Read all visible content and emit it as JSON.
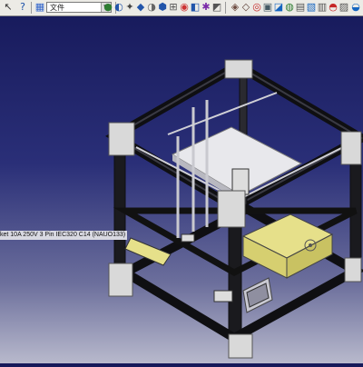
{
  "toolbar": {
    "combo_value": "文件",
    "icons_left": [
      "select-arrow-icon",
      "help-icon"
    ],
    "icons_mid": [
      "view-tool-icon-1",
      "view-tool-icon-2",
      "view-tool-icon-3",
      "view-tool-icon-4",
      "view-tool-icon-5",
      "view-tool-icon-6",
      "view-tool-icon-7",
      "view-tool-icon-8",
      "view-tool-icon-9",
      "view-tool-icon-10",
      "view-tool-icon-11"
    ],
    "icons_right": [
      "render-icon-1",
      "render-icon-2",
      "render-icon-3",
      "render-icon-4",
      "render-icon-5",
      "render-icon-6",
      "render-icon-7",
      "render-icon-8",
      "render-icon-9",
      "render-icon-10",
      "render-icon-11",
      "render-icon-12"
    ]
  },
  "viewport": {
    "part_tooltip": "ket 10A 250V 3 Pin IEC320 C14 (NAUO133)",
    "background_top": "#16195a",
    "background_bottom": "#b8b9cc",
    "frame_color": "#0f0f12",
    "bracket_color": "#d9d9d9",
    "psu_color": "#e6e08a"
  }
}
